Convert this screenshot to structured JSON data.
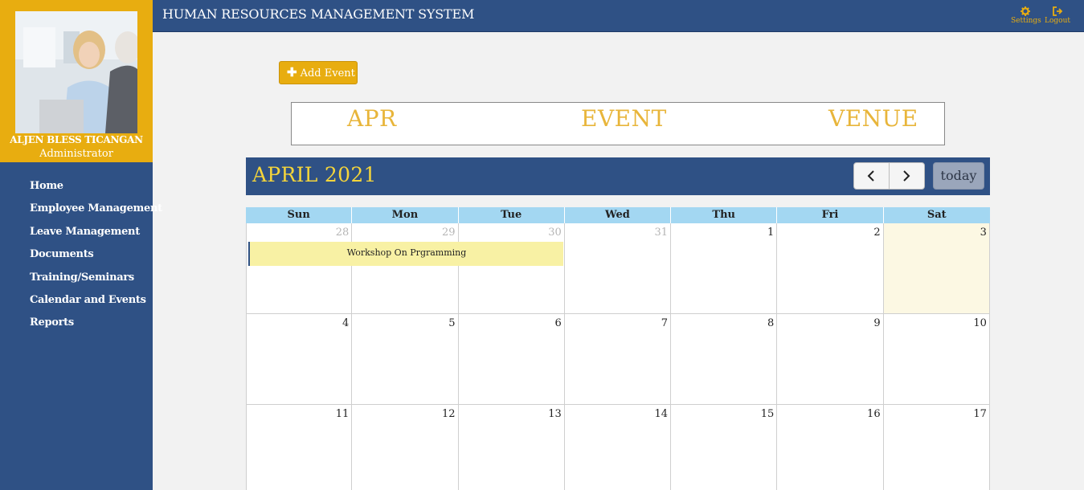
{
  "app": {
    "title": "HUMAN RESOURCES MANAGEMENT SYSTEM"
  },
  "header": {
    "settings_label": "Settings",
    "logout_label": "Logout"
  },
  "profile": {
    "name": "ALJEN BLESS TICANGAN",
    "role": "Administrator"
  },
  "sidebar": {
    "items": [
      {
        "label": "Home"
      },
      {
        "label": "Employee Management"
      },
      {
        "label": "Leave Management"
      },
      {
        "label": "Documents"
      },
      {
        "label": "Training/Seminars"
      },
      {
        "label": "Calendar and Events"
      },
      {
        "label": "Reports"
      }
    ]
  },
  "add_event_label": "Add Event",
  "event_box": {
    "col1": "APR",
    "col2": "EVENT",
    "col3": "VENUE"
  },
  "calendar": {
    "title": "APRIL 2021",
    "today_label": "today",
    "days_of_week": [
      "Sun",
      "Mon",
      "Tue",
      "Wed",
      "Thu",
      "Fri",
      "Sat"
    ],
    "weeks": [
      [
        "28",
        "29",
        "30",
        "31",
        "1",
        "2",
        "3"
      ],
      [
        "4",
        "5",
        "6",
        "7",
        "8",
        "9",
        "10"
      ],
      [
        "11",
        "12",
        "13",
        "14",
        "15",
        "16",
        "17"
      ]
    ],
    "events": [
      {
        "title": "Workshop On Prgramming"
      }
    ]
  },
  "colors": {
    "primary": "#2f5185",
    "accent": "#e8ad10",
    "title_yellow": "#f5d53a",
    "event_bg": "#f8f1a4",
    "today_bg": "#fcf8e3",
    "dow_bg": "#a3d7f2"
  },
  "icons": {
    "settings": "gear-icon",
    "logout": "sign-out-icon",
    "add": "plus-icon",
    "prev": "chevron-left-icon",
    "next": "chevron-right-icon"
  }
}
